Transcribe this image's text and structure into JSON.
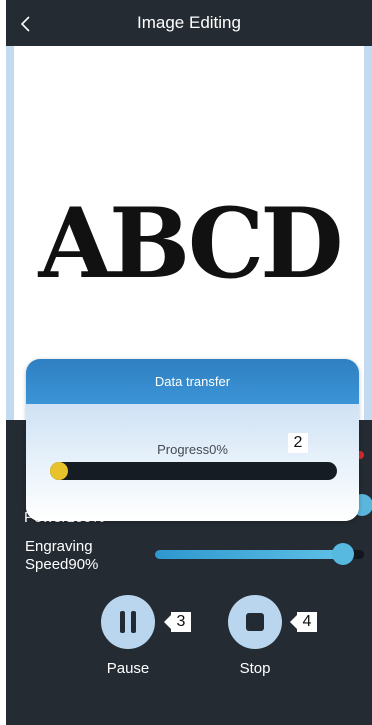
{
  "header": {
    "title": "Image Editing",
    "back_icon": "chevron-left-icon"
  },
  "canvas": {
    "text": "ABCD"
  },
  "controls": {
    "partial_power_label": "Power100%",
    "speed_label_line1": "Engraving",
    "speed_label_line2": "Speed90%",
    "speed_value": 0.9,
    "pause_label": "Pause",
    "stop_label": "Stop",
    "pause_icon": "pause-icon",
    "stop_icon": "stop-icon"
  },
  "dialog": {
    "title": "Data transfer",
    "progress_text": "Progress0%",
    "progress_value": 0
  },
  "badges": {
    "b2": "2",
    "b3": "3",
    "b4": "4"
  },
  "colors": {
    "background": "#242b33",
    "accent_blue": "#57b8e0",
    "dialog_header": "#3b95d6",
    "progress_knob": "#e8c22a",
    "button_bg": "#b9d6ee"
  }
}
